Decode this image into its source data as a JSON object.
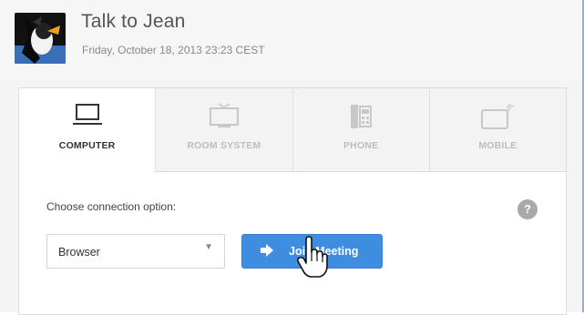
{
  "meeting": {
    "title": "Talk to Jean",
    "datetime": "Friday, October 18, 2013 23:23 CEST"
  },
  "tabs": [
    {
      "label": "COMPUTER",
      "icon": "laptop-icon",
      "active": true
    },
    {
      "label": "ROOM SYSTEM",
      "icon": "monitor-icon",
      "active": false
    },
    {
      "label": "PHONE",
      "icon": "desk-phone-icon",
      "active": false
    },
    {
      "label": "MOBILE",
      "icon": "tablet-icon",
      "active": false
    }
  ],
  "connection": {
    "prompt": "Choose connection option:",
    "selected": "Browser",
    "help": "?"
  },
  "join_button": {
    "label": "Join Meeting",
    "icon": "arrow-right-icon"
  },
  "colors": {
    "accent": "#3f8de0",
    "help": "#a9a9a9"
  }
}
